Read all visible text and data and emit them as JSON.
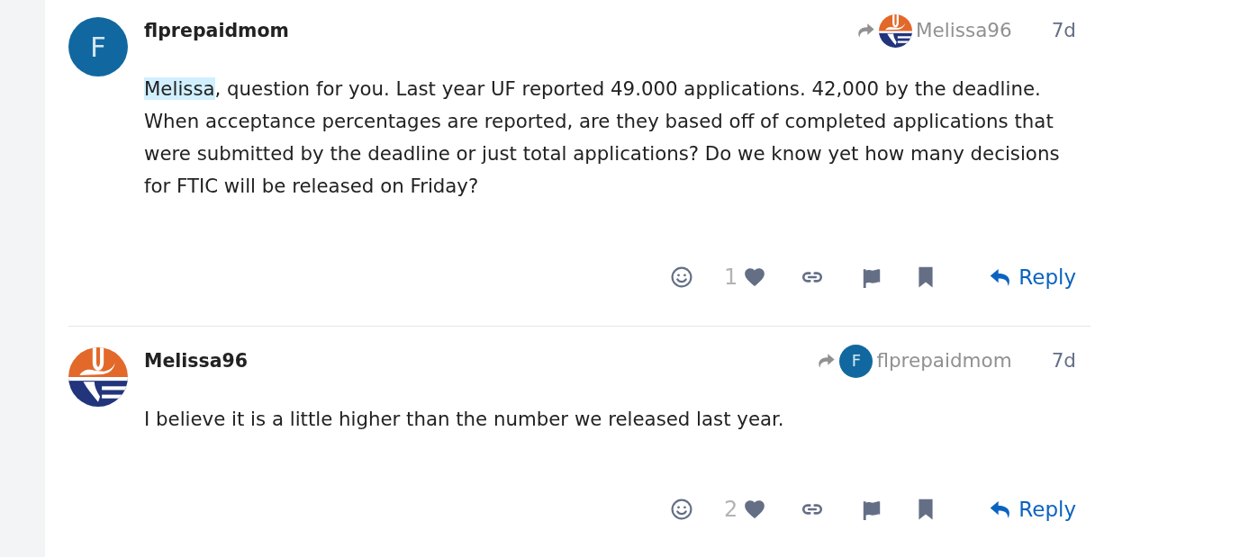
{
  "posts": [
    {
      "author": "flprepaidmom",
      "avatar": {
        "kind": "letter",
        "letter": "F"
      },
      "reply_to": {
        "avatar": {
          "kind": "logo"
        },
        "name": "Melissa96"
      },
      "date": "7d",
      "body": {
        "mention": "Melissa",
        "text": ", question for you. Last year UF reported 49.000 applications. 42,000 by the deadline. When acceptance percentages are reported, are they based off of completed applications that were submitted by the deadline or just total applications? Do we know yet how many decisions for FTIC will be released on Friday?"
      },
      "likes": "1",
      "reply_label": "Reply"
    },
    {
      "author": "Melissa96",
      "avatar": {
        "kind": "logo"
      },
      "reply_to": {
        "avatar": {
          "kind": "letter",
          "letter": "F"
        },
        "name": "flprepaidmom"
      },
      "date": "7d",
      "body": {
        "text": "I believe it is a little higher than the number we released last year."
      },
      "likes": "2",
      "reply_label": "Reply"
    }
  ]
}
